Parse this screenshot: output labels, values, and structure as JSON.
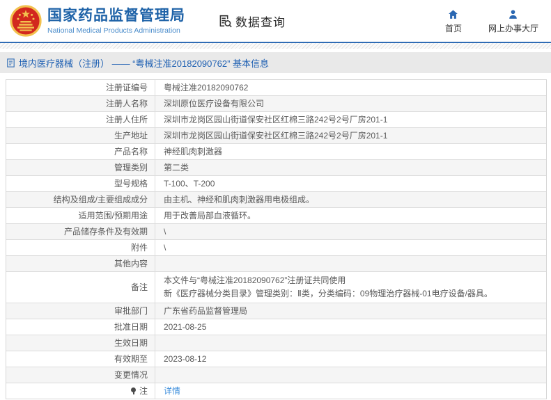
{
  "colors": {
    "brand_blue": "#1f63a8",
    "link_blue": "#3f8fdc",
    "title_blue": "#1d5fb2",
    "nav_icon_blue": "#2a67b2",
    "alt_row_bg": "#f5f5f5",
    "emblem_red": "#d2281e",
    "emblem_gold": "#f2c14e"
  },
  "header": {
    "logo": {
      "cn_title": "国家药品监督管理局",
      "en_title": "National Medical Products Administration"
    },
    "section_label": "数据查询",
    "nav": [
      {
        "label": "首页",
        "icon": "home-icon"
      },
      {
        "label": "网上办事大厅",
        "icon": "person-icon"
      }
    ]
  },
  "page_title": "境内医疗器械（注册） —— “粤械注准20182090762” 基本信息",
  "table": {
    "rows": [
      {
        "label": "注册证编号",
        "value": "粤械注准20182090762"
      },
      {
        "label": "注册人名称",
        "value": "深圳原位医疗设备有限公司"
      },
      {
        "label": "注册人住所",
        "value": "深圳市龙岗区园山街道保安社区红棉三路242号2号厂房201-1"
      },
      {
        "label": "生产地址",
        "value": "深圳市龙岗区园山街道保安社区红棉三路242号2号厂房201-1"
      },
      {
        "label": "产品名称",
        "value": "神经肌肉刺激器"
      },
      {
        "label": "管理类别",
        "value": "第二类"
      },
      {
        "label": "型号规格",
        "value": "T-100、T-200"
      },
      {
        "label": "结构及组成/主要组成成分",
        "value": "由主机、神经和肌肉刺激器用电极组成。"
      },
      {
        "label": "适用范围/预期用途",
        "value": "用于改善局部血液循环。"
      },
      {
        "label": "产品储存条件及有效期",
        "value": "\\"
      },
      {
        "label": "附件",
        "value": "\\"
      },
      {
        "label": "其他内容",
        "value": ""
      },
      {
        "label": "备注",
        "lines": [
          "本文件与“粤械注准20182090762”注册证共同使用",
          "新《医疗器械分类目录》管理类别：Ⅱ类，分类编码：09物理治疗器械-01电疗设备/器具。"
        ]
      },
      {
        "label": "审批部门",
        "value": "广东省药品监督管理局"
      },
      {
        "label": "批准日期",
        "value": "2021-08-25"
      },
      {
        "label": "生效日期",
        "value": ""
      },
      {
        "label": "有效期至",
        "value": "2023-08-12"
      },
      {
        "label": "变更情况",
        "value": ""
      },
      {
        "label": "注",
        "label_icon": "pin-icon",
        "link": "详情"
      }
    ]
  }
}
